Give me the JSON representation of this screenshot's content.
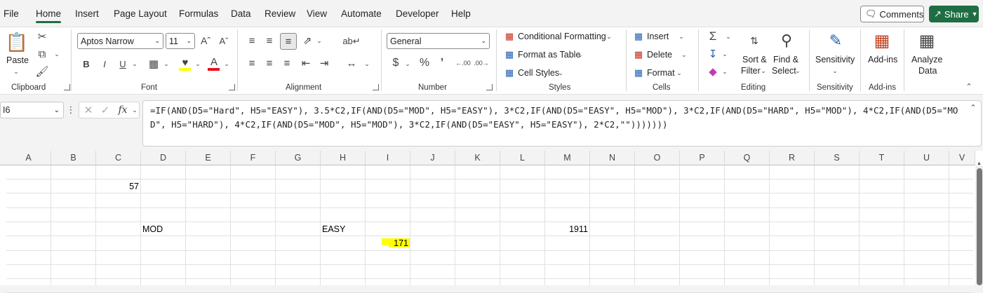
{
  "menu": {
    "items": [
      "File",
      "Home",
      "Insert",
      "Page Layout",
      "Formulas",
      "Data",
      "Review",
      "View",
      "Automate",
      "Developer",
      "Help"
    ],
    "active": "Home",
    "comments_label": "Comments",
    "share_label": "Share"
  },
  "ribbon": {
    "clipboard": {
      "paste_label": "Paste",
      "group_label": "Clipboard"
    },
    "font": {
      "font_name": "Aptos Narrow",
      "font_size": "11",
      "bold": "B",
      "italic": "I",
      "underline": "U",
      "group_label": "Font"
    },
    "alignment": {
      "group_label": "Alignment"
    },
    "number": {
      "format": "General",
      "group_label": "Number"
    },
    "styles": {
      "conditional_formatting": "Conditional Formatting",
      "format_as_table": "Format as Table",
      "cell_styles": "Cell Styles",
      "group_label": "Styles"
    },
    "cells": {
      "insert": "Insert",
      "delete": "Delete",
      "format": "Format",
      "group_label": "Cells"
    },
    "editing": {
      "sort_filter_1": "Sort &",
      "sort_filter_2": "Filter",
      "find_select_1": "Find &",
      "find_select_2": "Select",
      "group_label": "Editing"
    },
    "sensitivity": {
      "label": "Sensitivity",
      "group_label": "Sensitivity"
    },
    "addins": {
      "label": "Add-ins",
      "group_label": "Add-ins"
    },
    "analyze": {
      "label_1": "Analyze",
      "label_2": "Data"
    }
  },
  "formula_bar": {
    "name_box": "I6",
    "fx": "fx",
    "formula": "=IF(AND(D5=\"Hard\", H5=\"EASY\"), 3.5*C2,IF(AND(D5=\"MOD\", H5=\"EASY\"), 3*C2,IF(AND(D5=\"EASY\", H5=\"MOD\"), 3*C2,IF(AND(D5=\"HARD\", H5=\"MOD\"), 4*C2,IF(AND(D5=\"MOD\", H5=\"HARD\"), 4*C2,IF(AND(D5=\"MOD\", H5=\"MOD\"), 3*C2,IF(AND(D5=\"EASY\", H5=\"EASY\"), 2*C2,\"\")))))))"
  },
  "grid": {
    "columns": [
      "A",
      "B",
      "C",
      "D",
      "E",
      "F",
      "G",
      "H",
      "I",
      "J",
      "K",
      "L",
      "M",
      "N",
      "O",
      "P",
      "Q",
      "R",
      "S",
      "T",
      "U",
      "V"
    ],
    "cells": {
      "c2": "57",
      "d5": "MOD",
      "h5": "EASY",
      "m5": "1911",
      "i6": "171"
    },
    "highlight_color": "#ffff00"
  },
  "colors": {
    "accent": "#1f6e43"
  }
}
